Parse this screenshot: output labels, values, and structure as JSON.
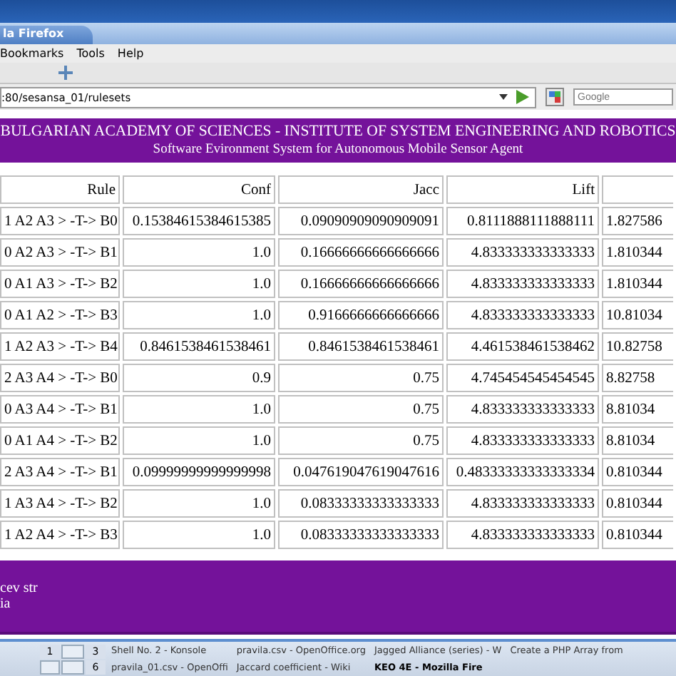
{
  "window": {
    "title": "la Firefox"
  },
  "menu": [
    "Bookmarks",
    "Tools",
    "Help"
  ],
  "address_bar": {
    "value": ":80/sesansa_01/rulesets"
  },
  "search": {
    "placeholder": "Google"
  },
  "header": {
    "title": "BULGARIAN ACADEMY OF SCIENCES - INSTITUTE OF SYSTEM ENGINEERING AND ROBOTICS",
    "subtitle": "Software Evironment System for Autonomous Mobile Sensor Agent"
  },
  "table": {
    "columns": [
      "Rule",
      "Conf",
      "Jacc",
      "Lift"
    ],
    "rows": [
      [
        "1 A2 A3 > -T-> B0",
        "0.15384615384615385",
        "0.09090909090909091",
        "0.8111888111888111",
        "1.827586"
      ],
      [
        "0 A2 A3 > -T-> B1",
        "1.0",
        "0.16666666666666666",
        "4.833333333333333",
        "1.810344"
      ],
      [
        "0 A1 A3 > -T-> B2",
        "1.0",
        "0.16666666666666666",
        "4.833333333333333",
        "1.810344"
      ],
      [
        "0 A1 A2 > -T-> B3",
        "1.0",
        "0.9166666666666666",
        "4.833333333333333",
        "10.81034"
      ],
      [
        "1 A2 A3 > -T-> B4",
        "0.8461538461538461",
        "0.8461538461538461",
        "4.461538461538462",
        "10.82758"
      ],
      [
        "2 A3 A4 > -T-> B0",
        "0.9",
        "0.75",
        "4.745454545454545",
        "8.82758"
      ],
      [
        "0 A3 A4 > -T-> B1",
        "1.0",
        "0.75",
        "4.833333333333333",
        "8.81034"
      ],
      [
        "0 A1 A4 > -T-> B2",
        "1.0",
        "0.75",
        "4.833333333333333",
        "8.81034"
      ],
      [
        "2 A3 A4 > -T-> B1",
        "0.09999999999999998",
        "0.047619047619047616",
        "0.48333333333333334",
        "0.810344"
      ],
      [
        "1 A3 A4 > -T-> B2",
        "1.0",
        "0.08333333333333333",
        "4.833333333333333",
        "0.810344"
      ],
      [
        "1 A2 A4 > -T-> B3",
        "1.0",
        "0.08333333333333333",
        "4.833333333333333",
        "0.810344"
      ]
    ]
  },
  "footer": {
    "lines": [
      "cev str",
      "ia"
    ]
  },
  "taskbar": {
    "desktops": [
      {
        "label": "1",
        "selected": false
      },
      {
        "label": "3",
        "selected": false
      },
      {
        "label": "6",
        "selected": false
      }
    ],
    "tasks": [
      {
        "label": "Shell No. 2 - Konsole",
        "selected": false
      },
      {
        "label": "pravila.csv - OpenOffice.org",
        "selected": false
      },
      {
        "label": "Jagged Alliance (series) - W",
        "selected": false
      },
      {
        "label": "Create a PHP Array from",
        "selected": false
      },
      {
        "label": "pravila_01.csv - OpenOffi",
        "selected": false
      },
      {
        "label": "Jaccard coefficient - Wiki",
        "selected": false
      },
      {
        "label": "KEO 4E - Mozilla Fire",
        "selected": true
      }
    ]
  }
}
